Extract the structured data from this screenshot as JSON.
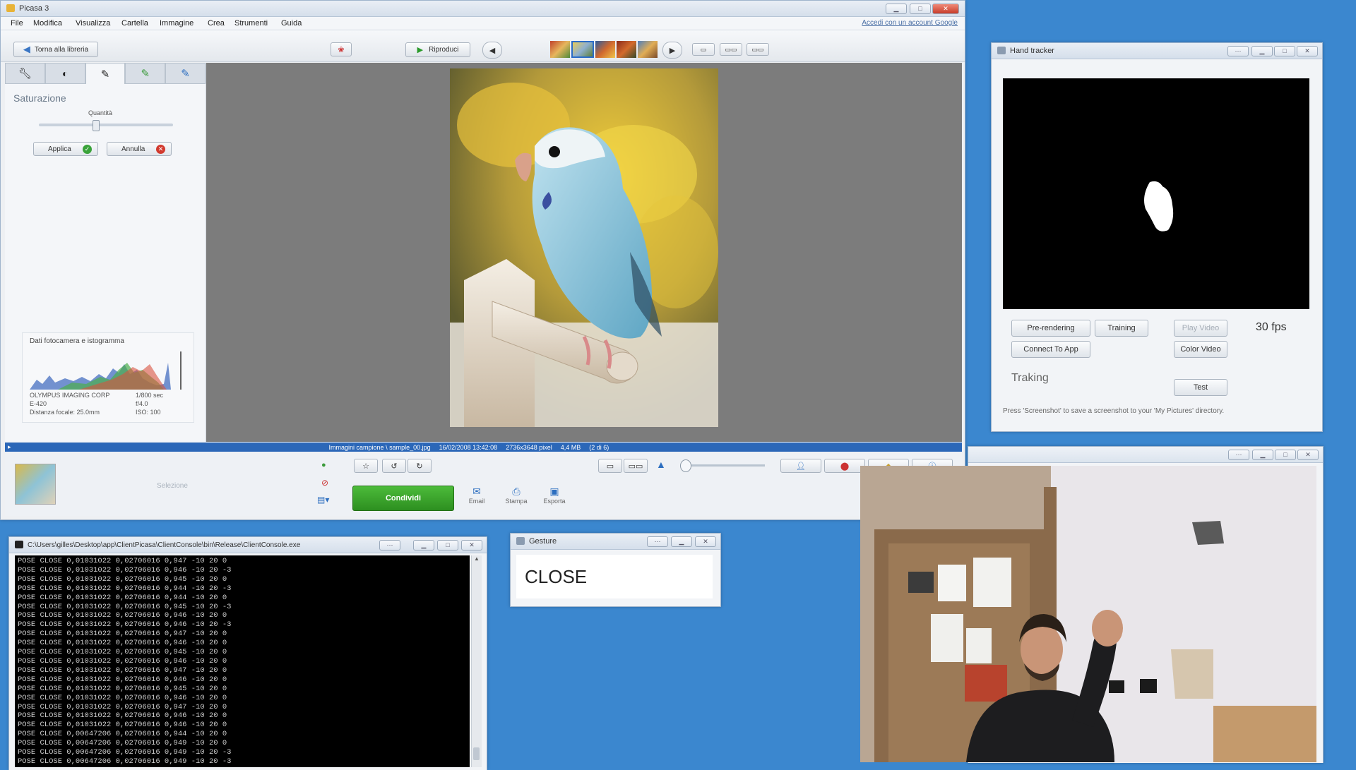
{
  "picasa": {
    "title": "Picasa 3",
    "menu": [
      "File",
      "Modifica",
      "Visualizza",
      "Cartella",
      "Immagine",
      "Crea",
      "Strumenti",
      "Guida"
    ],
    "account_link": "Accedi con un account Google",
    "back_button": "Torna alla libreria",
    "play_button": "Riproduci",
    "panel": {
      "title": "Saturazione",
      "slider_label": "Quantità",
      "slider_value": 0.42,
      "apply": "Applica",
      "cancel": "Annulla"
    },
    "camera_info": {
      "title": "Dati fotocamera e istogramma",
      "make": "OLYMPUS IMAGING CORP",
      "model": "E-420",
      "focal": "Distanza focale: 25.0mm",
      "shutter": "1/800 sec",
      "aperture": "f/4.0",
      "iso": "ISO: 100"
    },
    "status": {
      "path": "Immagini campione \\ sample_00.jpg",
      "date": "16/02/2008 13:42:08",
      "dims": "2736x3648 pixel",
      "size": "4,4 MB",
      "index": "(2 di 6)"
    },
    "tray_label": "Selezione",
    "share_button": "Condividi",
    "actions": [
      "Email",
      "Stampa",
      "Esporta"
    ]
  },
  "hand_tracker": {
    "title": "Hand tracker",
    "buttons": {
      "prerender": "Pre-rendering",
      "training": "Training",
      "play_video": "Play Video",
      "connect": "Connect To App",
      "color_video": "Color Video",
      "test": "Test"
    },
    "fps": "30 fps",
    "status": "Traking",
    "hint": "Press 'Screenshot' to save a screenshot to your 'My Pictures' directory."
  },
  "console": {
    "title": "C:\\Users\\gilles\\Desktop\\app\\ClientPicasa\\ClientConsole\\bin\\Release\\ClientConsole.exe",
    "lines": [
      "POSE CLOSE 0,01031022 0,02706016 0,947 -10 20 0",
      "POSE CLOSE 0,01031022 0,02706016 0,946 -10 20 -3",
      "POSE CLOSE 0,01031022 0,02706016 0,945 -10 20 0",
      "POSE CLOSE 0,01031022 0,02706016 0,944 -10 20 -3",
      "POSE CLOSE 0,01031022 0,02706016 0,944 -10 20 0",
      "POSE CLOSE 0,01031022 0,02706016 0,945 -10 20 -3",
      "POSE CLOSE 0,01031022 0,02706016 0,946 -10 20 0",
      "POSE CLOSE 0,01031022 0,02706016 0,946 -10 20 -3",
      "POSE CLOSE 0,01031022 0,02706016 0,947 -10 20 0",
      "POSE CLOSE 0,01031022 0,02706016 0,946 -10 20 0",
      "POSE CLOSE 0,01031022 0,02706016 0,945 -10 20 0",
      "POSE CLOSE 0,01031022 0,02706016 0,946 -10 20 0",
      "POSE CLOSE 0,01031022 0,02706016 0,947 -10 20 0",
      "POSE CLOSE 0,01031022 0,02706016 0,946 -10 20 0",
      "POSE CLOSE 0,01031022 0,02706016 0,945 -10 20 0",
      "POSE CLOSE 0,01031022 0,02706016 0,946 -10 20 0",
      "POSE CLOSE 0,01031022 0,02706016 0,947 -10 20 0",
      "POSE CLOSE 0,01031022 0,02706016 0,946 -10 20 0",
      "POSE CLOSE 0,01031022 0,02706016 0,946 -10 20 0",
      "POSE CLOSE 0,00647206 0,02706016 0,944 -10 20 0",
      "POSE CLOSE 0,00647206 0,02706016 0,949 -10 20 0",
      "POSE CLOSE 0,00647206 0,02706016 0,949 -10 20 -3",
      "POSE CLOSE 0,00647206 0,02706016 0,949 -10 20 -3"
    ]
  },
  "gesture": {
    "title": "Gesture",
    "value": "CLOSE"
  }
}
